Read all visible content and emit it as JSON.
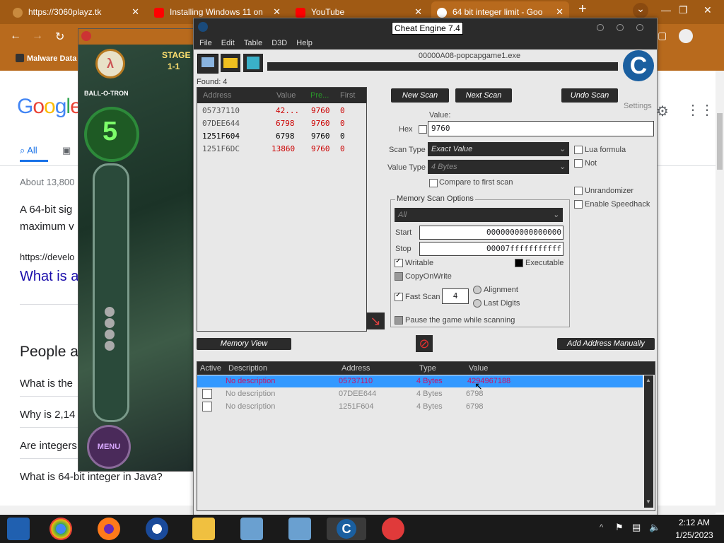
{
  "browser": {
    "tabs": [
      {
        "label": "https://3060playz.tk",
        "color": "#ffffff"
      },
      {
        "label": "Installing Windows 11 on",
        "color": "#ff0000"
      },
      {
        "label": "YouTube",
        "color": "#ff0000"
      },
      {
        "label": "64 bit integer limit - Goo",
        "color": "#4285f4"
      }
    ],
    "bookmark": "Malware Data"
  },
  "google": {
    "logo": "Google",
    "tab_all": "All",
    "about": "About 13,800",
    "snippet_1": "A 64-bit sig",
    "snippet_2": "maximum v",
    "url": "https://develo",
    "result_title": "What is a",
    "people_also": "People a",
    "q1": "What is the",
    "q2": "Why is 2,14",
    "q3": "Are integers",
    "q4": "What is 64-bit integer in Java?"
  },
  "game": {
    "stage": "STAGE",
    "stage_num": "1-1",
    "ball_o_tron": "BALL-O-TRON",
    "count": "5",
    "menu": "MENU"
  },
  "ce": {
    "title": "Cheat Engine 7.4",
    "menu": [
      "File",
      "Edit",
      "Table",
      "D3D",
      "Help"
    ],
    "process": "00000A08-popcapgame1.exe",
    "found": "Found: 4",
    "results_headers": [
      "Address",
      "Value",
      "Pre...",
      "First"
    ],
    "results": [
      {
        "address": "05737110",
        "value": "42...",
        "prev": "9760",
        "first": "0",
        "changed": true
      },
      {
        "address": "07DEE644",
        "value": "6798",
        "prev": "9760",
        "first": "0",
        "changed": true
      },
      {
        "address": "1251F604",
        "value": "6798",
        "prev": "9760",
        "first": "0",
        "changed": false
      },
      {
        "address": "1251F6DC",
        "value": "13860",
        "prev": "9760",
        "first": "0",
        "changed": true
      }
    ],
    "new_scan": "New Scan",
    "next_scan": "Next Scan",
    "undo_scan": "Undo Scan",
    "settings": "Settings",
    "value_label": "Value:",
    "hex_label": "Hex",
    "value": "9760",
    "scan_type_label": "Scan Type",
    "scan_type": "Exact Value",
    "value_type_label": "Value Type",
    "value_type": "4 Bytes",
    "compare_first": "Compare to first scan",
    "lua_formula": "Lua formula",
    "not_label": "Not",
    "unrandomizer": "Unrandomizer",
    "enable_speedhack": "Enable Speedhack",
    "memory_scan_options": "Memory Scan Options",
    "region": "All",
    "start_label": "Start",
    "start": "0000000000000000",
    "stop_label": "Stop",
    "stop": "00007fffffffffff",
    "writable": "Writable",
    "executable": "Executable",
    "copy_on_write": "CopyOnWrite",
    "fast_scan": "Fast Scan",
    "fast_scan_value": "4",
    "alignment": "Alignment",
    "last_digits": "Last Digits",
    "pause_game": "Pause the game while scanning",
    "memory_view": "Memory View",
    "add_address": "Add Address Manually",
    "table_headers": [
      "Active",
      "Description",
      "Address",
      "Type",
      "Value"
    ],
    "table_rows": [
      {
        "description": "No description",
        "address": "05737110",
        "type": "4 Bytes",
        "value": "4294967188",
        "selected": true
      },
      {
        "description": "No description",
        "address": "07DEE644",
        "type": "4 Bytes",
        "value": "6798",
        "selected": false
      },
      {
        "description": "No description",
        "address": "1251F604",
        "type": "4 Bytes",
        "value": "6798",
        "selected": false
      }
    ]
  },
  "taskbar": {
    "time": "2:12 AM",
    "date": "1/25/2023"
  },
  "colors": {
    "chrome": "#b86a1d",
    "ce_dark": "#2b2b2b",
    "selected_row": "#3399ff",
    "changed_value": "#cc0000"
  }
}
